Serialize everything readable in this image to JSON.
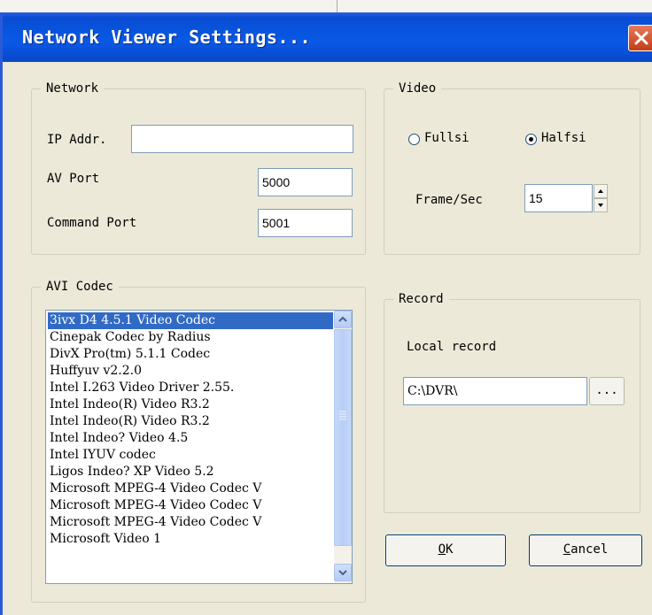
{
  "window": {
    "title": "Network Viewer Settings..."
  },
  "network": {
    "legend": "Network",
    "ip_label": "IP Addr.",
    "ip_value": "",
    "av_port_label": "AV Port",
    "av_port_value": "5000",
    "command_port_label": "Command Port",
    "command_port_value": "5001"
  },
  "video": {
    "legend": "Video",
    "fullsize_label": "Fullsi",
    "halfsize_label": "Halfsi",
    "selected": "Halfsi",
    "fps_label": "Frame/Sec",
    "fps_value": "15"
  },
  "avi_codec": {
    "legend": "AVI Codec",
    "selected_index": 0,
    "items": [
      "3ivx D4 4.5.1 Video Codec",
      "Cinepak Codec by Radius",
      "DivX Pro(tm) 5.1.1 Codec",
      "Huffyuv v2.2.0",
      "Intel I.263 Video Driver 2.55.",
      "Intel Indeo(R) Video R3.2",
      "Intel Indeo(R) Video R3.2",
      "Intel Indeo? Video 4.5",
      "Intel IYUV codec",
      "Ligos Indeo? XP Video 5.2",
      "Microsoft MPEG-4 Video Codec V",
      "Microsoft MPEG-4 Video Codec V",
      "Microsoft MPEG-4 Video Codec V",
      "Microsoft Video 1"
    ]
  },
  "record": {
    "legend": "Record",
    "local_record_label": "Local record",
    "path_value": "C:\\DVR\\",
    "browse_label": "..."
  },
  "buttons": {
    "ok_mnemonic": "O",
    "ok_rest": "K",
    "cancel_mnemonic": "C",
    "cancel_rest": "ancel"
  },
  "colors": {
    "titlebar": "#0a58e6",
    "selection": "#316ac5",
    "dialog_bg": "#ece9d8",
    "close_button": "#c33c15"
  }
}
